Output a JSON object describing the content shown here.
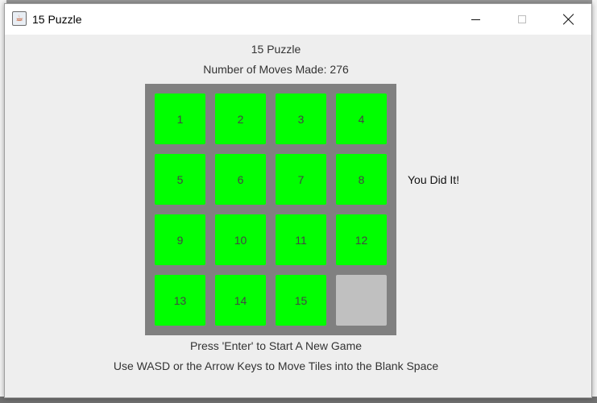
{
  "window": {
    "title": "15 Puzzle",
    "icon": "java-icon"
  },
  "game": {
    "heading": "15 Puzzle",
    "moves_text": "Number of Moves Made: 276",
    "status": "You Did It!",
    "instructions": [
      "Press 'Enter' to Start A New Game",
      "Use WASD or the Arrow Keys to Move Tiles into the Blank Space"
    ]
  },
  "board": {
    "rows": [
      [
        "1",
        "2",
        "3",
        "4"
      ],
      [
        "5",
        "6",
        "7",
        "8"
      ],
      [
        "9",
        "10",
        "11",
        "12"
      ],
      [
        "13",
        "14",
        "15",
        ""
      ]
    ],
    "tile_color": "#00ff00",
    "blank_color": "#c0c0c0",
    "board_color": "#808080"
  }
}
